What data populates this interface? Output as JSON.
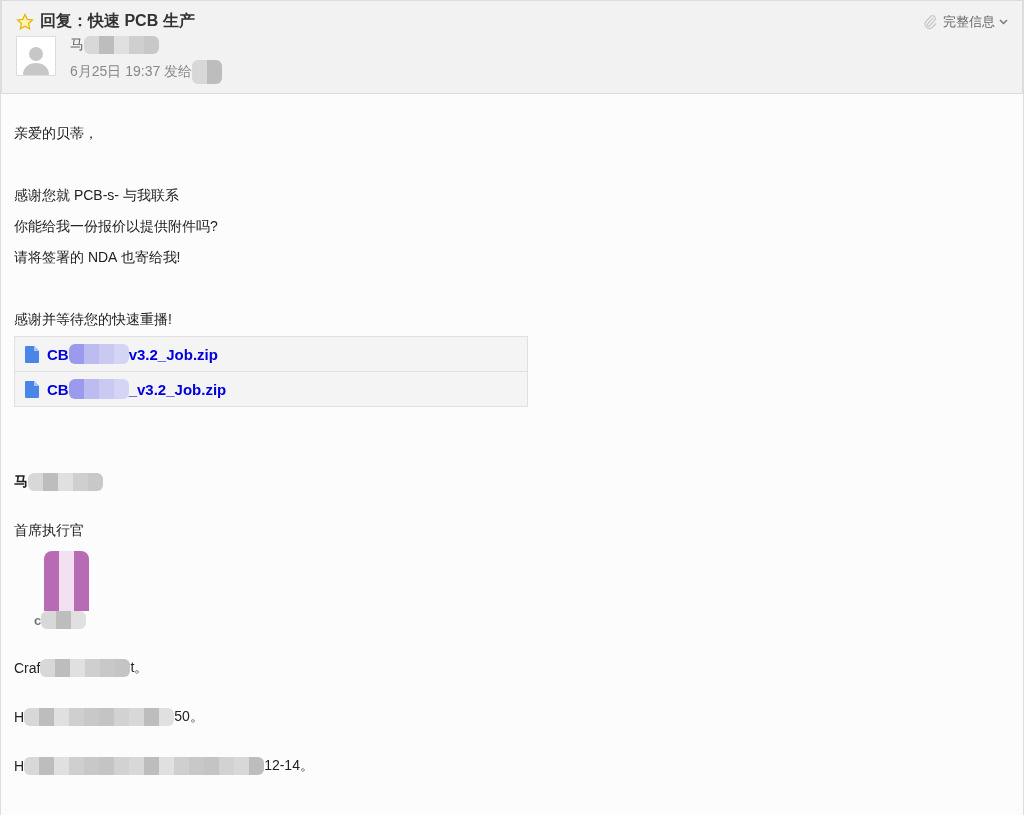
{
  "header": {
    "starred": false,
    "subject": "回复：快速 PCB 生产",
    "sender": {
      "before": "马",
      "redacted": true
    },
    "date": {
      "before": "6月25日 19:37 发给",
      "redacted": true
    },
    "details_link": "完整信息"
  },
  "body": {
    "lines": [
      {
        "kind": "text",
        "text": "亲爱的贝蒂，"
      },
      {
        "kind": "blank"
      },
      {
        "kind": "text",
        "text": "感谢您就 PCB-s- 与我联系"
      },
      {
        "kind": "text",
        "text": "你能给我一份报价以提供附件吗?"
      },
      {
        "kind": "text",
        "text": "请将签署的 NDA 也寄给我!"
      },
      {
        "kind": "blank"
      },
      {
        "kind": "text",
        "text": "感谢并等待您的快速重播!"
      }
    ],
    "attachments": [
      {
        "before": "CB",
        "after": "v3.2_Job.zip",
        "redacted": true
      },
      {
        "before": "CB",
        "after": "_v3.2_Job.zip",
        "redacted": true
      }
    ],
    "signature": {
      "name": {
        "before": "马",
        "redacted": true
      },
      "title": "首席执行官",
      "logo": {
        "text": "c",
        "redacted": true
      },
      "lines": [
        {
          "before": "Craf",
          "after": "t。",
          "redacted": true
        },
        {
          "before": "H",
          "after": "50。",
          "redacted": true
        },
        {
          "before": "H",
          "after": "12-14。",
          "redacted": true
        }
      ]
    }
  }
}
